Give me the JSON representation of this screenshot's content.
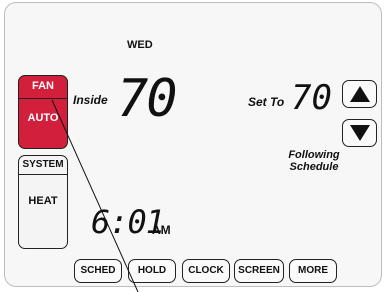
{
  "header": {
    "day": "WED"
  },
  "fan": {
    "title": "FAN",
    "mode": "AUTO"
  },
  "system": {
    "title": "SYSTEM",
    "mode": "HEAT"
  },
  "inside": {
    "label": "Inside",
    "temp": "70"
  },
  "setpoint": {
    "label": "Set To",
    "temp": "70"
  },
  "schedule_status": {
    "line1": "Following",
    "line2": "Schedule"
  },
  "clock": {
    "time": "6:01",
    "ampm": "AM"
  },
  "buttons": [
    "SCHED",
    "HOLD",
    "CLOCK",
    "SCREEN",
    "MORE"
  ],
  "colors": {
    "fan_active": "#d21f3c",
    "background": "#f7f7f7"
  },
  "icons": {
    "up": "up-arrow-icon",
    "down": "down-arrow-icon"
  }
}
